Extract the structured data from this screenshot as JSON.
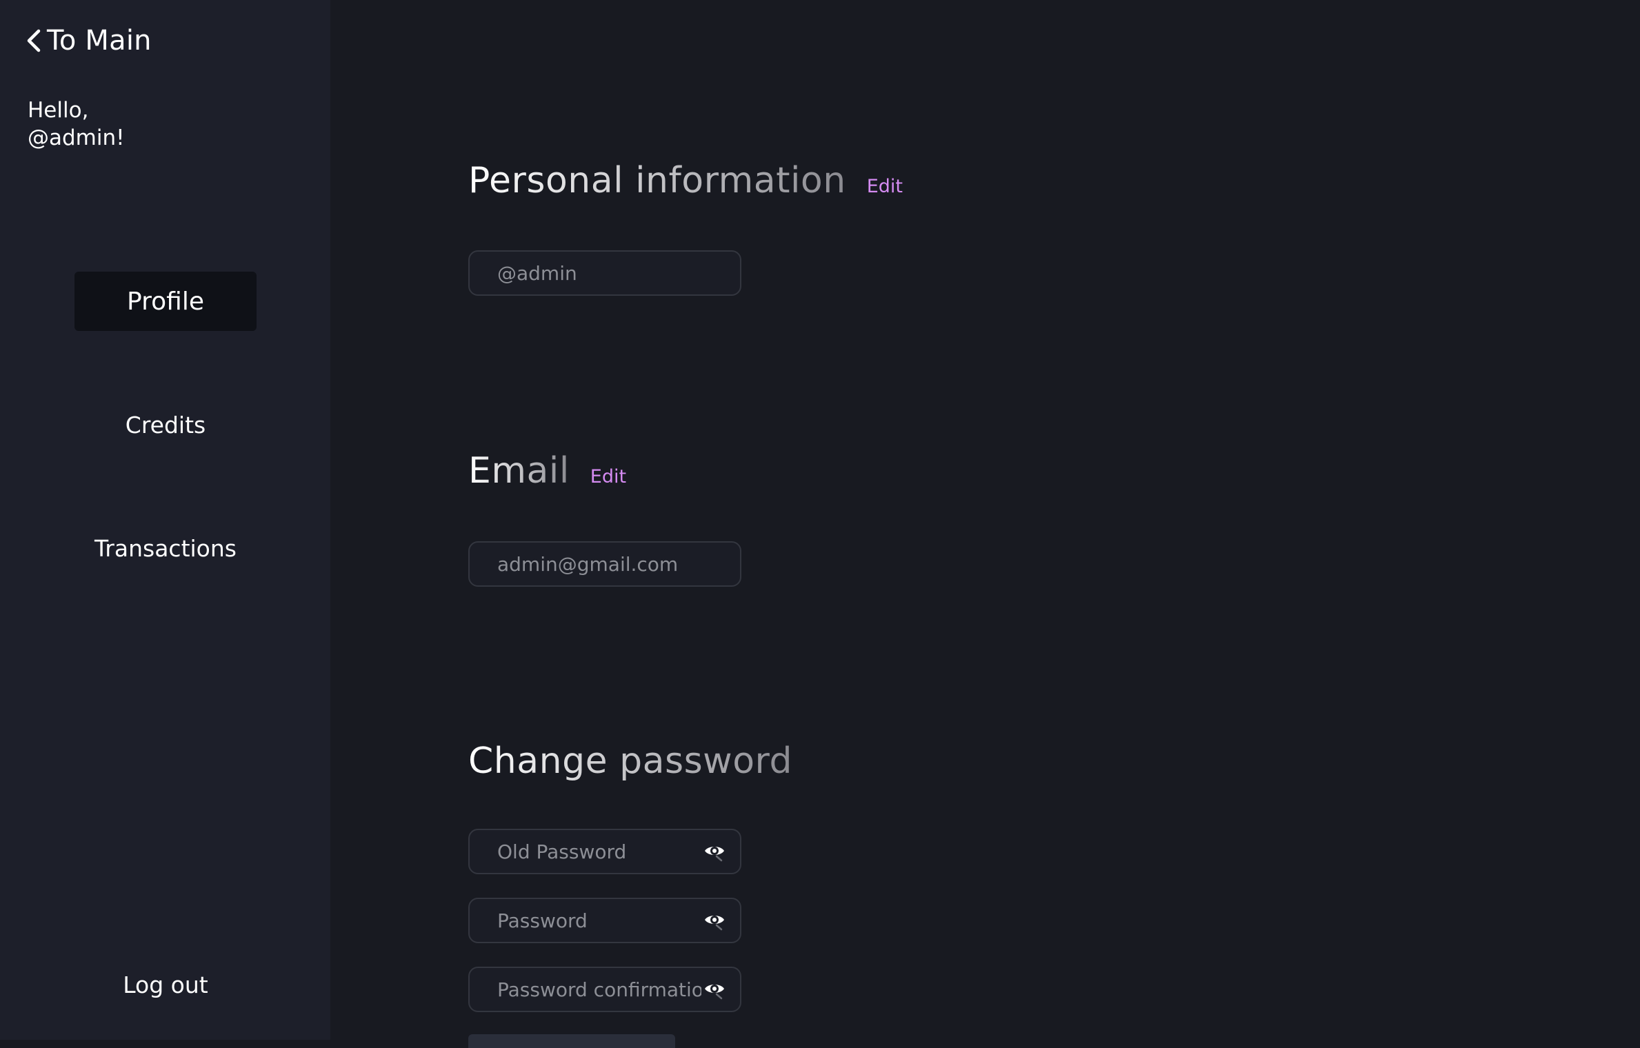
{
  "sidebar": {
    "back_label": "To Main",
    "greeting_line1": "Hello,",
    "greeting_line2": "@admin!",
    "nav": [
      {
        "label": "Profile",
        "active": true
      },
      {
        "label": "Credits",
        "active": false
      },
      {
        "label": "Transactions",
        "active": false
      }
    ],
    "logout_label": "Log out"
  },
  "main": {
    "personal": {
      "title": "Personal information",
      "edit_label": "Edit",
      "username_placeholder": "@admin"
    },
    "email": {
      "title": "Email",
      "edit_label": "Edit",
      "email_placeholder": "admin@gmail.com"
    },
    "password": {
      "title": "Change password",
      "old_placeholder": "Old Password",
      "new_placeholder": "Password",
      "confirm_placeholder": "Password confirmation"
    }
  },
  "colors": {
    "background": "#181a21",
    "sidebar": "#1d1f2a",
    "active_nav": "#0f1117",
    "accent_edit": "#d58bf2",
    "field_border": "#33363f"
  },
  "icons": {
    "back": "chevron-left-icon",
    "password_toggle": "eye-icon"
  }
}
